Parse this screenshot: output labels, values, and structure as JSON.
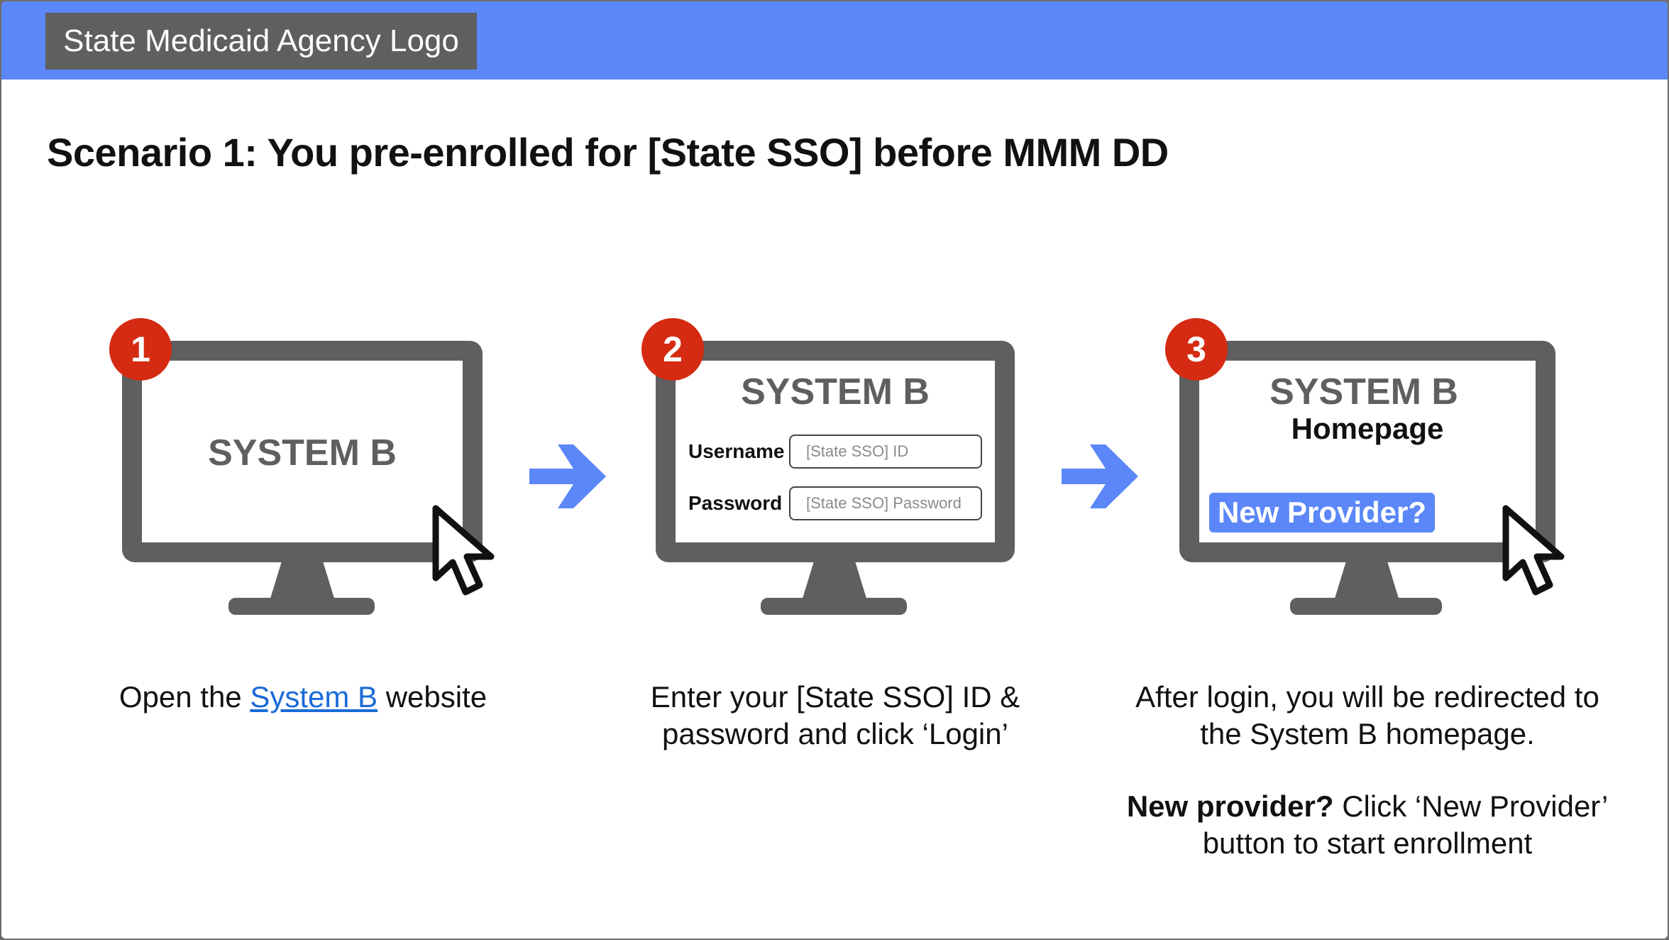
{
  "header": {
    "logo_text": "State Medicaid Agency Logo"
  },
  "title": "Scenario 1: You pre-enrolled for [State SSO] before MMM DD",
  "steps": [
    {
      "number": "1",
      "screen_title": "SYSTEM B",
      "caption_before": "Open the ",
      "caption_link": "System B",
      "caption_after": " website"
    },
    {
      "number": "2",
      "screen_title": "SYSTEM B",
      "username_label": "Username",
      "username_placeholder": "[State SSO] ID",
      "password_label": "Password",
      "password_placeholder": "[State SSO] Password",
      "caption_line1": "Enter your [State SSO] ID &",
      "caption_line2": "password and click ‘Login’"
    },
    {
      "number": "3",
      "screen_title": "SYSTEM B",
      "screen_subtitle": "Homepage",
      "button_label": "New Provider?",
      "caption_line1": "After login, you will be redirected to",
      "caption_line2": "the System B homepage.",
      "caption_bold": "New provider?",
      "caption_line3": " Click ‘New Provider’",
      "caption_line4": "button to start enrollment"
    }
  ],
  "colors": {
    "header_bar": "#5b87f8",
    "logo_box": "#5f5f5f",
    "badge": "#d42b12",
    "monitor": "#5f5f5f",
    "arrow": "#5b87f8",
    "link": "#1a6bd6"
  },
  "icons": [
    "arrow-right-icon",
    "mouse-pointer-icon",
    "monitor-icon"
  ]
}
